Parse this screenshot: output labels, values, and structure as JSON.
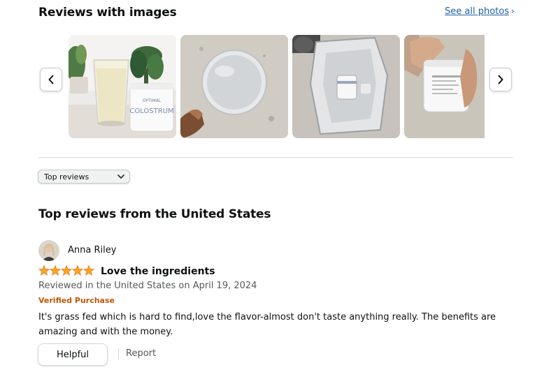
{
  "images_section": {
    "title": "Reviews with images",
    "see_all": "See all photos",
    "colors": {
      "link": "#2162a1"
    },
    "thumbnails": [
      {
        "name": "colostrum-drink-jar",
        "label_line1": "OPTIMAL",
        "label_line2": "COLOSTRUM"
      },
      {
        "name": "mixed-drink-top-view"
      },
      {
        "name": "jar-in-shipping-bag"
      },
      {
        "name": "hand-holding-jar"
      }
    ]
  },
  "sort": {
    "selected": "Top reviews"
  },
  "reviews_section": {
    "title": "Top reviews from the United States",
    "review": {
      "author": "Anna Riley",
      "rating": 5,
      "title": "Love the ingredients",
      "reviewed": "Reviewed in the United States on April 19, 2024",
      "verified": "Verified Purchase",
      "body": "It's grass fed which is hard to find,love the flavor-almost don't taste anything really. The benefits are amazing and with the money.",
      "helpful": "Helpful",
      "report": "Report"
    }
  }
}
